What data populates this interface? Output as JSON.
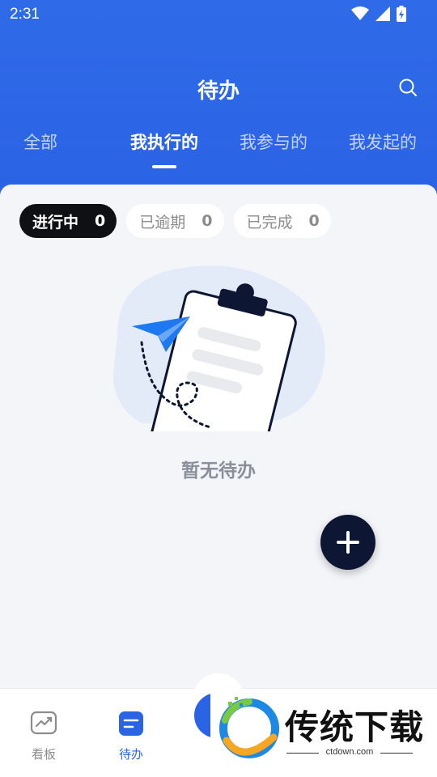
{
  "status_bar": {
    "time": "2:31"
  },
  "header": {
    "title": "待办"
  },
  "tabs": [
    {
      "label": "全部"
    },
    {
      "label": "我执行的"
    },
    {
      "label": "我参与的"
    },
    {
      "label": "我发起的"
    }
  ],
  "active_tab": "我执行的",
  "filters": [
    {
      "label": "进行中",
      "count": "0"
    },
    {
      "label": "已逾期",
      "count": "0"
    },
    {
      "label": "已完成",
      "count": "0"
    }
  ],
  "empty_state": {
    "text": "暂无待办"
  },
  "bottom_nav": [
    {
      "label": "看板",
      "icon": "chart-board-icon"
    },
    {
      "label": "待办",
      "icon": "todo-icon"
    }
  ],
  "watermark": {
    "title": "传统下载",
    "url": "ctdown.com"
  },
  "colors": {
    "primary": "#2a63e4",
    "fab": "#0d1733",
    "active_chip": "#0f1014"
  }
}
